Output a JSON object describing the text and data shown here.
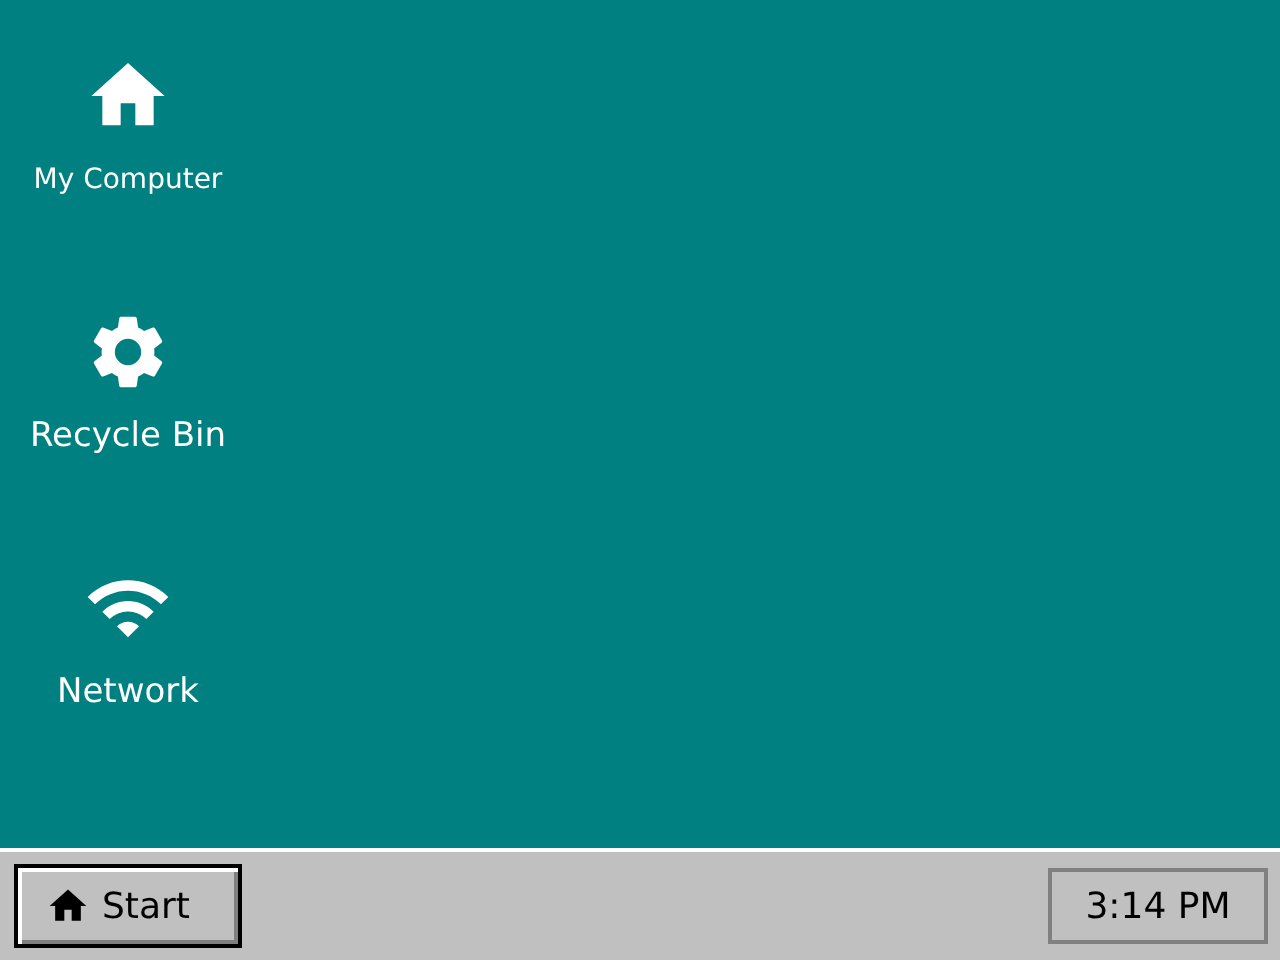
{
  "desktop_icons": [
    {
      "kind": "home",
      "label": "My Computer"
    },
    {
      "kind": "gear",
      "label": "Recycle Bin"
    },
    {
      "kind": "wifi",
      "label": "Network"
    }
  ],
  "taskbar": {
    "start_button": "Start",
    "clock": "3:14 PM"
  }
}
